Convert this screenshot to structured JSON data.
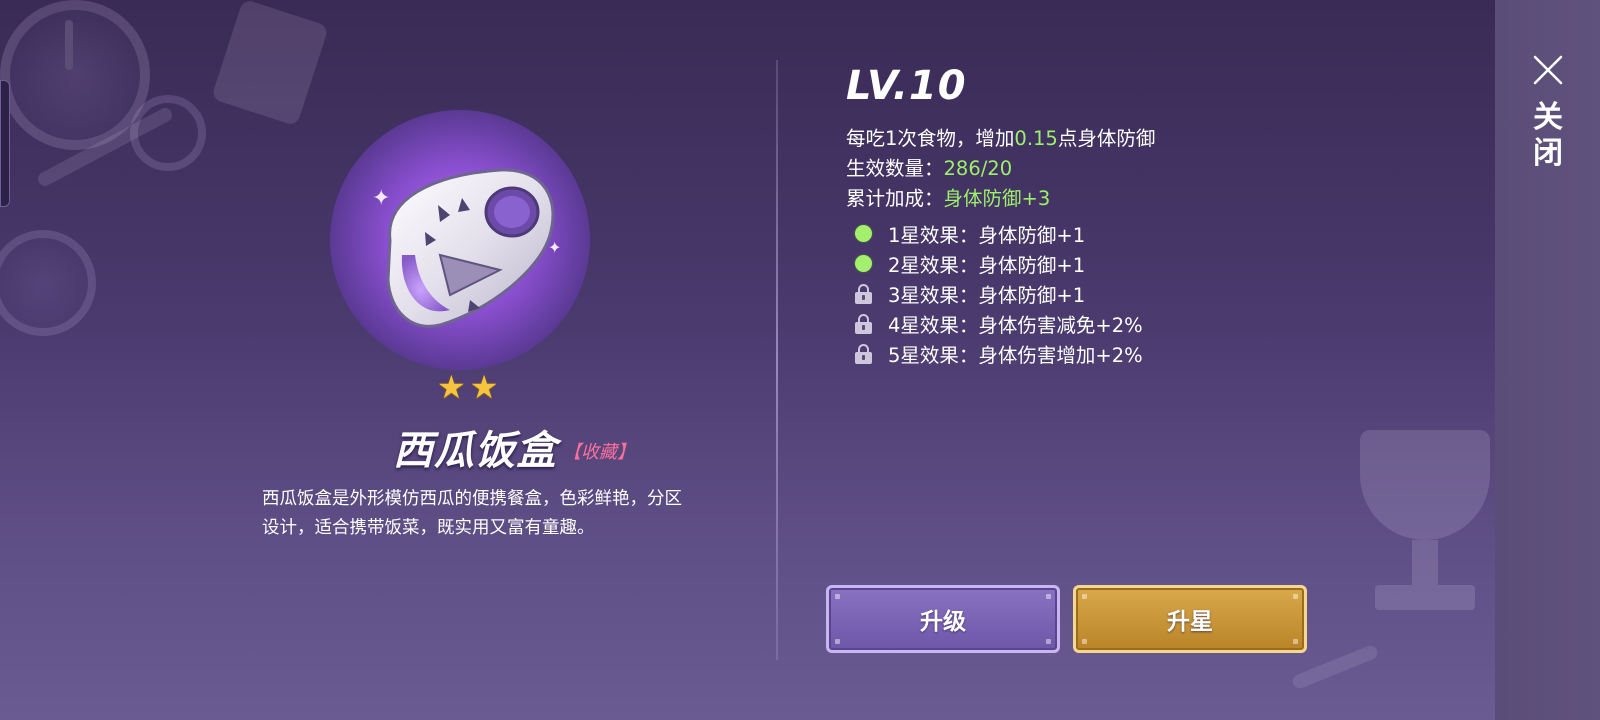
{
  "item": {
    "name": "西瓜饭盒",
    "tag": "【收藏】",
    "stars": 2,
    "description": "西瓜饭盒是外形模仿西瓜的便携餐盒，色彩鲜艳，分区设计，适合携带饭菜，既实用又富有童趣。"
  },
  "details": {
    "level": "LV.10",
    "per_food": {
      "prefix": "每吃1次食物，增加",
      "value": "0.15",
      "suffix": "点身体防御"
    },
    "effective_count": {
      "label": "生效数量：",
      "value": "286/20"
    },
    "cumulative_bonus": {
      "label": "累计加成：",
      "value": "身体防御+3"
    },
    "star_effects": [
      {
        "label": "1星效果：身体防御+1",
        "unlocked": true
      },
      {
        "label": "2星效果：身体防御+1",
        "unlocked": true
      },
      {
        "label": "3星效果：身体防御+1",
        "unlocked": false
      },
      {
        "label": "4星效果：身体伤害减免+2%",
        "unlocked": false
      },
      {
        "label": "5星效果：身体伤害增加+2%",
        "unlocked": false
      }
    ]
  },
  "buttons": {
    "upgrade": "升级",
    "star_up": "升星"
  },
  "side": {
    "close_label": "关闭"
  },
  "colors": {
    "highlight_green": "#9df06a",
    "tag_pink": "#ff6f9c",
    "star_gold": "#f5c542",
    "button_gold": "#c8922f",
    "button_purple": "#7b64b5"
  },
  "icons": {
    "star": "star-icon",
    "unlocked": "green-dot-icon",
    "locked": "lock-icon",
    "close": "close-icon"
  }
}
